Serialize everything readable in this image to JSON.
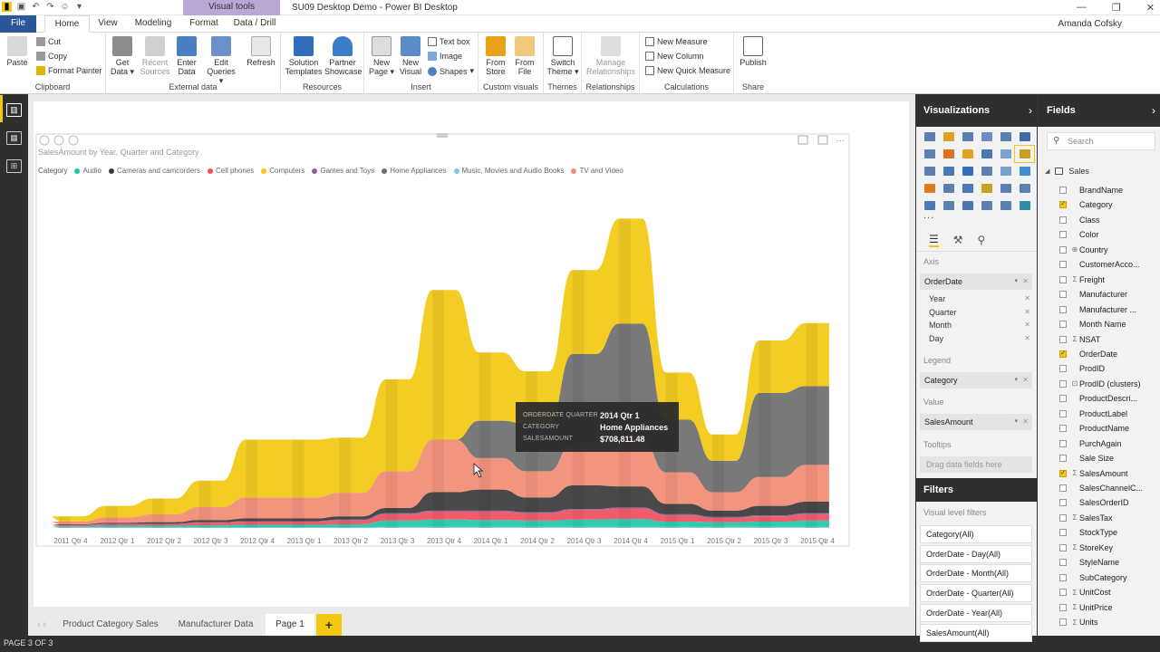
{
  "app": {
    "window_title": "SU09 Desktop Demo - Power BI Desktop",
    "context_tab": "Visual tools",
    "user": "Amanda Cofsky"
  },
  "tabs": [
    "File",
    "Home",
    "View",
    "Modeling",
    "Format",
    "Data / Drill"
  ],
  "ribbon": {
    "clipboard": {
      "paste": "Paste",
      "cut": "Cut",
      "copy": "Copy",
      "format_painter": "Format Painter",
      "label": "Clipboard"
    },
    "external": {
      "get_data": "Get Data",
      "recent_sources": "Recent Sources",
      "enter_data": "Enter Data",
      "edit_queries": "Edit Queries",
      "refresh": "Refresh",
      "label": "External data"
    },
    "resources": {
      "solution_templates": "Solution Templates",
      "partner_showcase": "Partner Showcase",
      "label": "Resources"
    },
    "insert": {
      "new_page": "New Page",
      "new_visual": "New Visual",
      "text_box": "Text box",
      "image": "Image",
      "shapes": "Shapes",
      "label": "Insert"
    },
    "custom_visuals": {
      "from_store": "From Store",
      "from_file": "From File",
      "label": "Custom visuals"
    },
    "themes": {
      "switch_theme": "Switch Theme",
      "label": "Themes"
    },
    "relationships": {
      "manage": "Manage Relationships",
      "label": "Relationships"
    },
    "calculations": {
      "new_measure": "New Measure",
      "new_column": "New Column",
      "new_quick_measure": "New Quick Measure",
      "label": "Calculations"
    },
    "share": {
      "publish": "Publish",
      "label": "Share"
    }
  },
  "visual": {
    "title": "SalesAmount by Year, Quarter and Category",
    "legend_title": "Category"
  },
  "colors": {
    "Audio": "#1fc5a8",
    "Cameras and camcorders": "#3a3a3a",
    "Cell phones": "#f04e5e",
    "Computers": "#f2c811",
    "Games and Toys": "#8f5c95",
    "Home Appliances": "#6e6e6e",
    "Music, Movies and Audio Books": "#7ec8e3",
    "TV and Video": "#f28b73"
  },
  "chart_data": {
    "type": "area",
    "subtype": "streamgraph",
    "title": "SalesAmount by Year, Quarter and Category",
    "categories": [
      "2011 Qtr 4",
      "2012 Qtr 1",
      "2012 Qtr 2",
      "2012 Qtr 3",
      "2012 Qtr 4",
      "2013 Qtr 1",
      "2013 Qtr 2",
      "2013 Qtr 3",
      "2013 Qtr 4",
      "2014 Qtr 1",
      "2014 Qtr 2",
      "2014 Qtr 3",
      "2014 Qtr 4",
      "2015 Qtr 1",
      "2015 Qtr 2",
      "2015 Qtr 3",
      "2015 Qtr 4"
    ],
    "series": [
      {
        "name": "Audio",
        "values": [
          0.02,
          0.03,
          0.03,
          0.04,
          0.05,
          0.05,
          0.06,
          0.12,
          0.14,
          0.13,
          0.12,
          0.14,
          0.15,
          0.1,
          0.09,
          0.1,
          0.12
        ]
      },
      {
        "name": "Cameras and camcorders",
        "values": [
          0.01,
          0.02,
          0.03,
          0.04,
          0.05,
          0.05,
          0.06,
          0.1,
          0.35,
          0.4,
          0.28,
          0.45,
          0.4,
          0.2,
          0.12,
          0.18,
          0.22
        ]
      },
      {
        "name": "Cell phones",
        "values": [
          0.02,
          0.03,
          0.03,
          0.05,
          0.06,
          0.06,
          0.07,
          0.12,
          0.15,
          0.16,
          0.14,
          0.18,
          0.2,
          0.12,
          0.08,
          0.1,
          0.12
        ]
      },
      {
        "name": "Computers",
        "values": [
          0.1,
          0.22,
          0.3,
          0.5,
          1.1,
          1.1,
          1.05,
          1.75,
          2.85,
          1.3,
          1.0,
          1.6,
          2.0,
          0.9,
          0.5,
          1.0,
          1.2
        ]
      },
      {
        "name": "Games and Toys",
        "values": [
          0.01,
          0.01,
          0.01,
          0.01,
          0.01,
          0.01,
          0.02,
          0.02,
          0.02,
          0.02,
          0.02,
          0.02,
          0.02,
          0.02,
          0.02,
          0.02,
          0.02
        ]
      },
      {
        "name": "Home Appliances",
        "values": [
          0.0,
          0.0,
          0.0,
          0.0,
          0.0,
          0.0,
          0.0,
          0.0,
          0.0,
          0.71,
          0.9,
          1.7,
          2.2,
          1.0,
          0.6,
          1.6,
          1.5
        ]
      },
      {
        "name": "Music, Movies and Audio Books",
        "values": [
          0.01,
          0.01,
          0.01,
          0.01,
          0.01,
          0.01,
          0.01,
          0.02,
          0.02,
          0.02,
          0.02,
          0.02,
          0.02,
          0.02,
          0.02,
          0.02,
          0.02
        ]
      },
      {
        "name": "TV and Video",
        "values": [
          0.05,
          0.1,
          0.15,
          0.25,
          0.4,
          0.4,
          0.45,
          0.7,
          1.0,
          0.6,
          0.5,
          0.8,
          0.9,
          0.6,
          0.35,
          0.55,
          0.7
        ]
      }
    ],
    "legend": "top-left",
    "grid": false
  },
  "tooltip": {
    "k1": "ORDERDATE QUARTER",
    "v1": "2014 Qtr 1",
    "k2": "CATEGORY",
    "v2": "Home Appliances",
    "k3": "SALESAMOUNT",
    "v3": "$708,811.48"
  },
  "page_tabs": [
    "Product Category Sales",
    "Manufacturer Data",
    "Page 1"
  ],
  "add_page": "+",
  "status": "PAGE 3 OF 3",
  "viz_pane": {
    "title": "Visualizations",
    "more": "...",
    "axis_label": "Axis",
    "axis_field": "OrderDate",
    "axis_sub": [
      "Year",
      "Quarter",
      "Month",
      "Day"
    ],
    "legend_label": "Legend",
    "legend_field": "Category",
    "value_label": "Value",
    "value_field": "SalesAmount",
    "tooltips_label": "Tooltips",
    "drag_hint": "Drag data fields here",
    "filters_title": "Filters",
    "visual_filters": "Visual level filters",
    "filters": [
      "Category(All)",
      "OrderDate - Day(All)",
      "OrderDate - Month(All)",
      "OrderDate - Quarter(All)",
      "OrderDate - Year(All)",
      "SalesAmount(All)"
    ]
  },
  "fields_pane": {
    "title": "Fields",
    "search_placeholder": "Search",
    "table": "Sales",
    "fields": [
      {
        "name": "BrandName",
        "checked": false,
        "icon": ""
      },
      {
        "name": "Category",
        "checked": true,
        "icon": ""
      },
      {
        "name": "Class",
        "checked": false,
        "icon": ""
      },
      {
        "name": "Color",
        "checked": false,
        "icon": ""
      },
      {
        "name": "Country",
        "checked": false,
        "icon": "globe"
      },
      {
        "name": "CustomerAcco...",
        "checked": false,
        "icon": ""
      },
      {
        "name": "Freight",
        "checked": false,
        "icon": "sigma"
      },
      {
        "name": "Manufacturer",
        "checked": false,
        "icon": ""
      },
      {
        "name": "Manufacturer ...",
        "checked": false,
        "icon": ""
      },
      {
        "name": "Month Name",
        "checked": false,
        "icon": ""
      },
      {
        "name": "NSAT",
        "checked": false,
        "icon": "sigma"
      },
      {
        "name": "OrderDate",
        "checked": true,
        "icon": ""
      },
      {
        "name": "ProdID",
        "checked": false,
        "icon": ""
      },
      {
        "name": "ProdID (clusters)",
        "checked": false,
        "icon": "cluster"
      },
      {
        "name": "ProductDescri...",
        "checked": false,
        "icon": ""
      },
      {
        "name": "ProductLabel",
        "checked": false,
        "icon": ""
      },
      {
        "name": "ProductName",
        "checked": false,
        "icon": ""
      },
      {
        "name": "PurchAgain",
        "checked": false,
        "icon": ""
      },
      {
        "name": "Sale Size",
        "checked": false,
        "icon": ""
      },
      {
        "name": "SalesAmount",
        "checked": true,
        "icon": "sigma"
      },
      {
        "name": "SalesChannelC...",
        "checked": false,
        "icon": ""
      },
      {
        "name": "SalesOrderID",
        "checked": false,
        "icon": ""
      },
      {
        "name": "SalesTax",
        "checked": false,
        "icon": "sigma"
      },
      {
        "name": "StockType",
        "checked": false,
        "icon": ""
      },
      {
        "name": "StoreKey",
        "checked": false,
        "icon": "sigma"
      },
      {
        "name": "StyleName",
        "checked": false,
        "icon": ""
      },
      {
        "name": "SubCategory",
        "checked": false,
        "icon": ""
      },
      {
        "name": "UnitCost",
        "checked": false,
        "icon": "sigma"
      },
      {
        "name": "UnitPrice",
        "checked": false,
        "icon": "sigma"
      },
      {
        "name": "Units",
        "checked": false,
        "icon": "sigma"
      }
    ]
  }
}
